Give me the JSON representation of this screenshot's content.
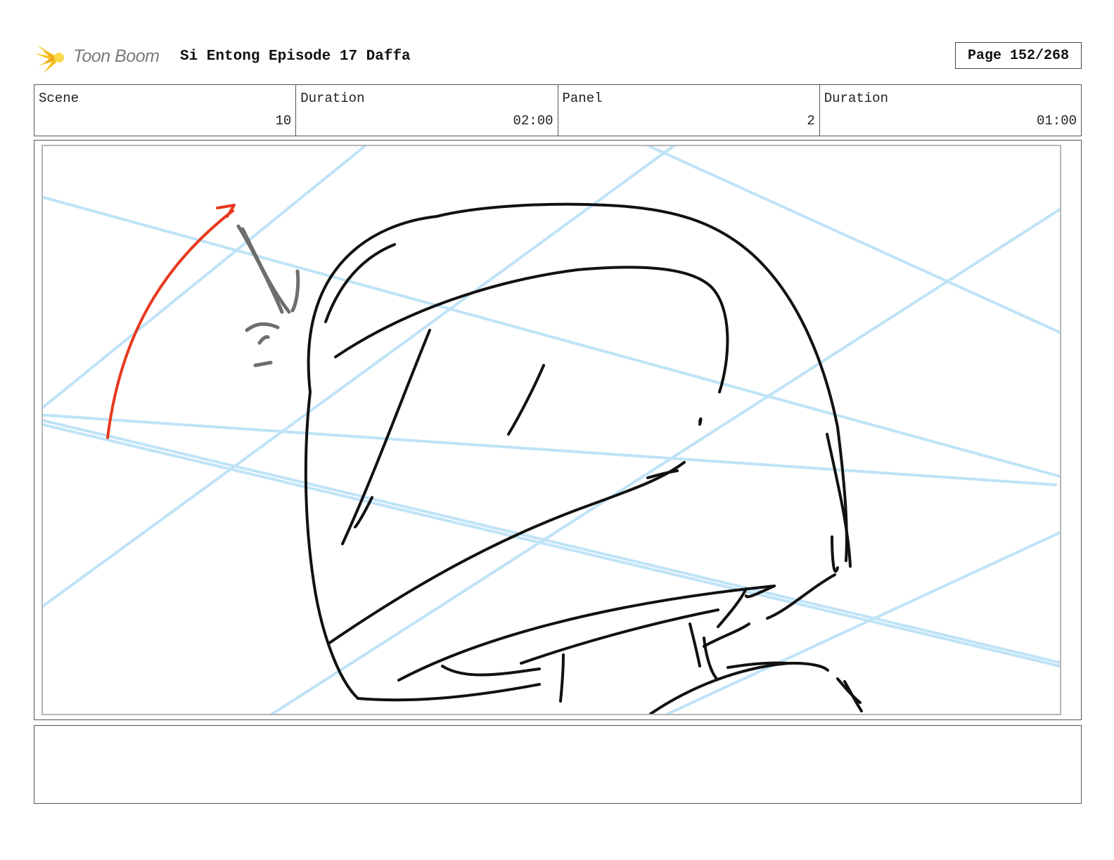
{
  "header": {
    "logo_text": "Toon Boom",
    "project_title": "Si Entong Episode 17 Daffa",
    "page_label": "Page 152/268"
  },
  "info": {
    "scene_label": "Scene",
    "scene_value": "10",
    "scene_duration_label": "Duration",
    "scene_duration_value": "02:00",
    "panel_label": "Panel",
    "panel_value": "2",
    "panel_duration_label": "Duration",
    "panel_duration_value": "01:00"
  },
  "panel": {
    "guide_line_color": "#bfe3f7",
    "sketch_color": "#111111",
    "accent_arrow_color": "#e8391e",
    "motion_lines_color": "#6e6e6e"
  },
  "notes": {
    "text": ""
  }
}
